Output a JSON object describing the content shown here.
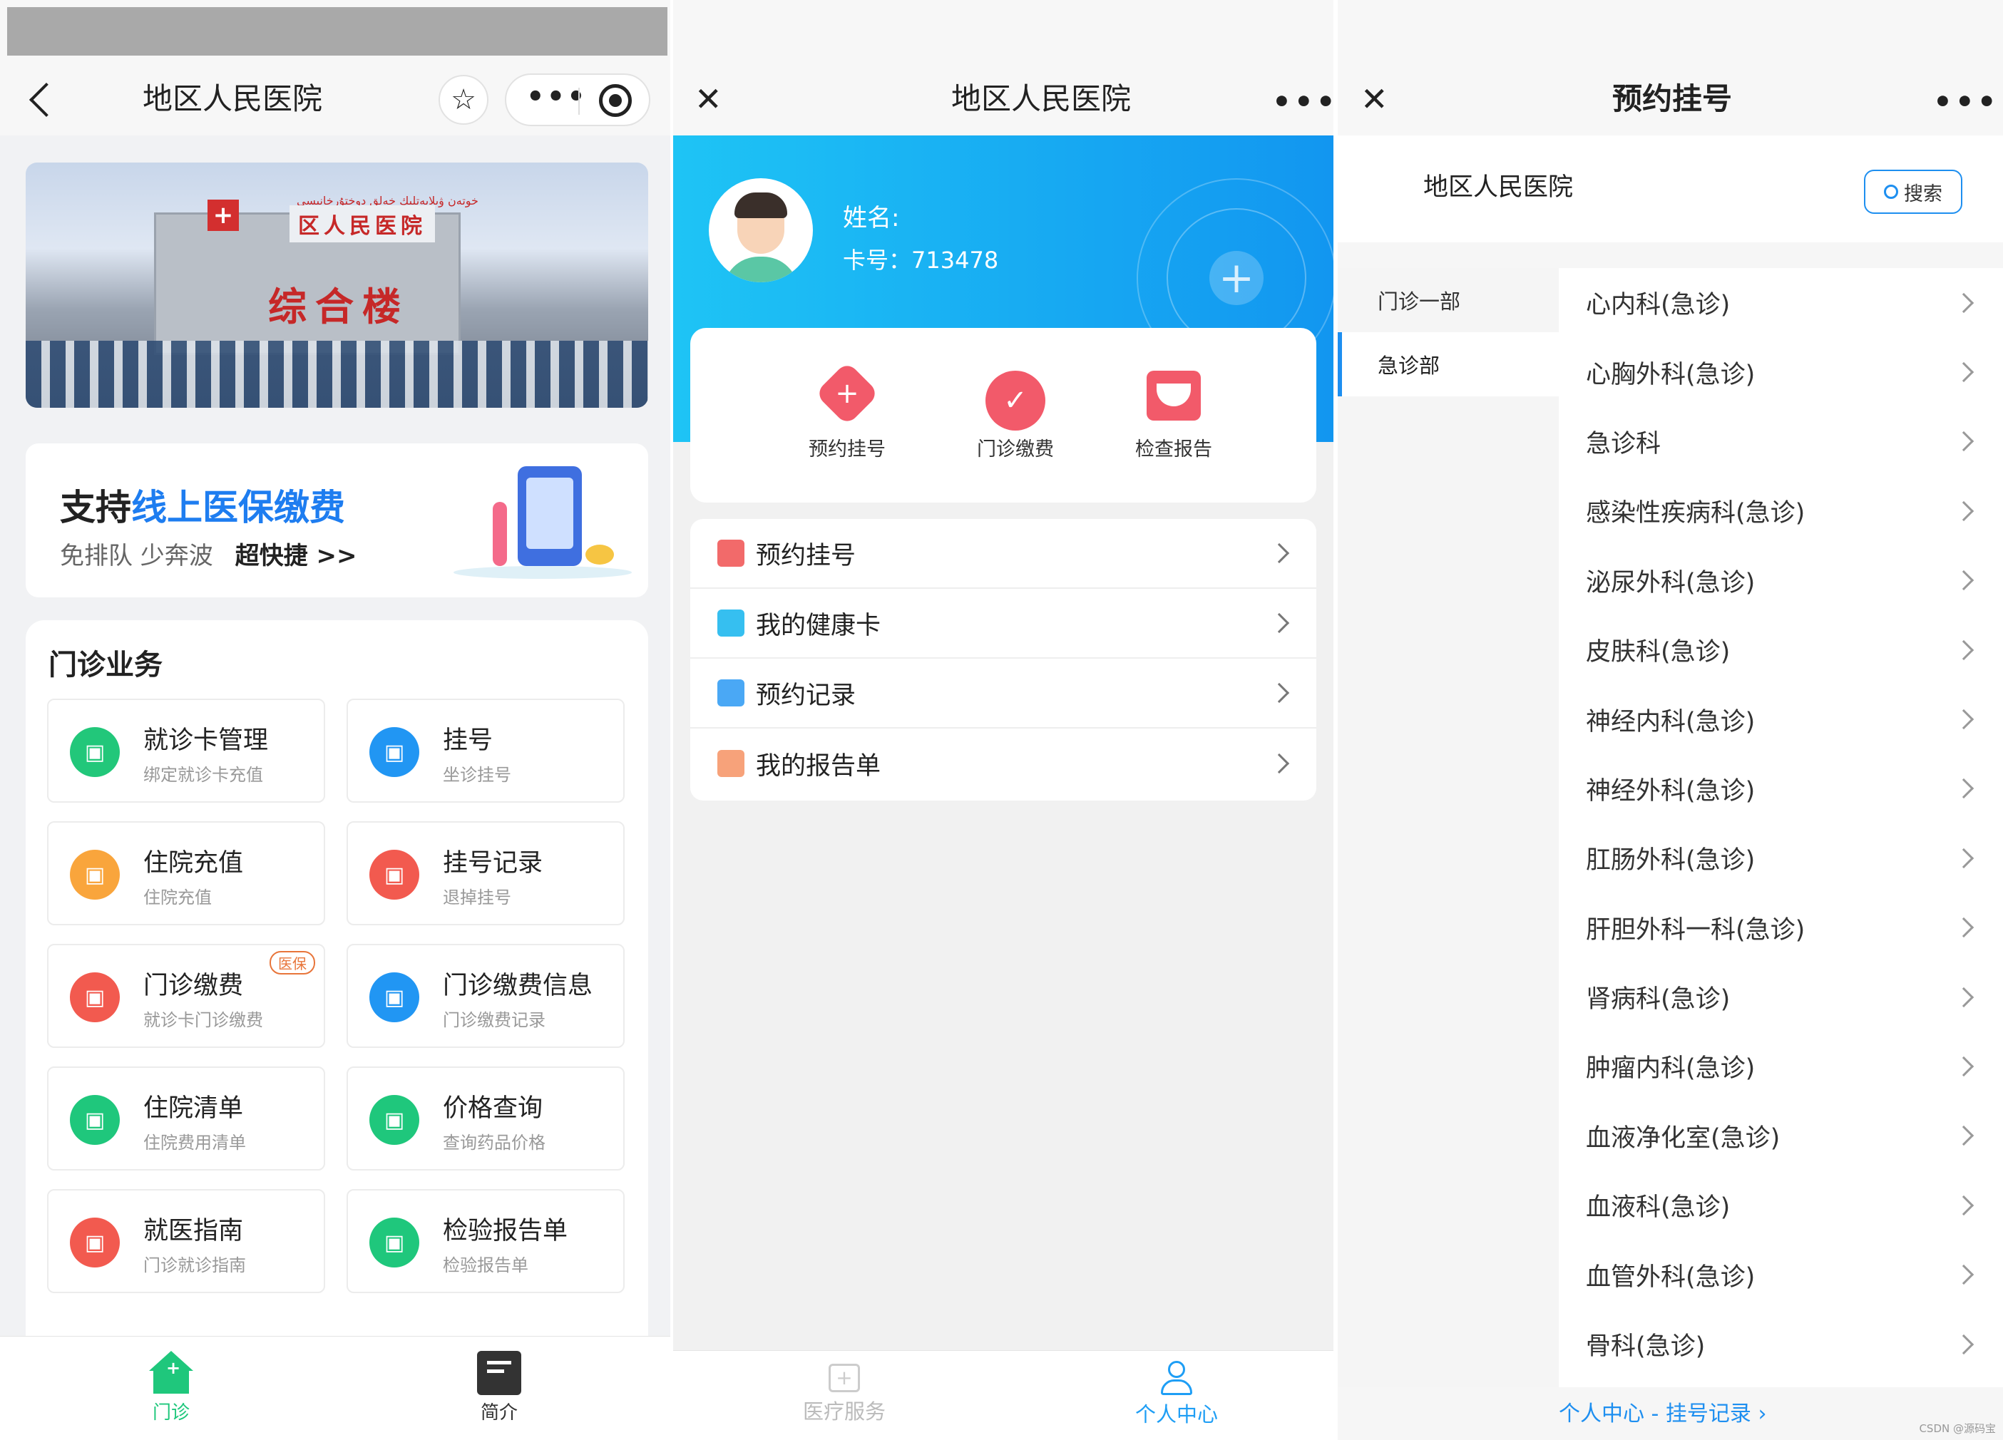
{
  "panel1": {
    "title": "地区人民医院",
    "banner": {
      "sign_top": "خوتەن ۋىلايەتلىك خەلق دوختۇرخانىسى",
      "sign": "区人民医院",
      "building": "综合楼"
    },
    "promo": {
      "line1_a": "支持",
      "line1_b": "线上医保缴费",
      "line2_a": "免排队 少奔波",
      "line2_b": "超快捷 >>"
    },
    "section_title": "门诊业务",
    "tiles": [
      {
        "title": "就诊卡管理",
        "sub": "绑定就诊卡充值",
        "color": "#22c77a",
        "icon": "card-icon"
      },
      {
        "title": "挂号",
        "sub": "坐诊挂号",
        "color": "#2196f3",
        "icon": "clock-icon"
      },
      {
        "title": "住院充值",
        "sub": "住院充值",
        "color": "#f9a53c",
        "icon": "recharge-icon"
      },
      {
        "title": "挂号记录",
        "sub": "退掉挂号",
        "color": "#f25a4f",
        "icon": "refund-icon"
      },
      {
        "title": "门诊缴费",
        "sub": "就诊卡门诊缴费",
        "color": "#f25a4f",
        "icon": "payment-icon",
        "badge": "医保"
      },
      {
        "title": "门诊缴费信息",
        "sub": "门诊缴费记录",
        "color": "#2196f3",
        "icon": "list-icon"
      },
      {
        "title": "住院清单",
        "sub": "住院费用清单",
        "color": "#1fc77c",
        "icon": "bill-icon"
      },
      {
        "title": "价格查询",
        "sub": "查询药品价格",
        "color": "#1fc77c",
        "icon": "price-icon"
      },
      {
        "title": "就医指南",
        "sub": "门诊就诊指南",
        "color": "#f25a4f",
        "icon": "guide-icon"
      },
      {
        "title": "检验报告单",
        "sub": "检验报告单",
        "color": "#1fc77c",
        "icon": "report-icon"
      }
    ],
    "tabs": [
      {
        "label": "门诊",
        "color": "#1fc77c"
      },
      {
        "label": "简介",
        "color": "#333333"
      }
    ]
  },
  "panel2": {
    "title": "地区人民医院",
    "name_label": "姓名:",
    "card_label": "卡号：",
    "card_no": "713478",
    "features": [
      {
        "label": "预约挂号",
        "color": "#f25a6a"
      },
      {
        "label": "门诊缴费",
        "color": "#f25a6a"
      },
      {
        "label": "检查报告",
        "color": "#f25a6a"
      }
    ],
    "menu": [
      {
        "label": "预约挂号",
        "color": "#f26a6a"
      },
      {
        "label": "我的健康卡",
        "color": "#36bff0"
      },
      {
        "label": "预约记录",
        "color": "#4aa8f5"
      },
      {
        "label": "我的报告单",
        "color": "#f7a27a"
      }
    ],
    "tabs": [
      {
        "label": "医疗服务",
        "color": "#bbbbbb"
      },
      {
        "label": "个人中心",
        "color": "#1e9ef5"
      }
    ]
  },
  "panel3": {
    "title": "预约挂号",
    "hospital": "地区人民医院",
    "search": "搜索",
    "sidebar": [
      {
        "label": "门诊一部"
      },
      {
        "label": "急诊部"
      }
    ],
    "departments": [
      "心内科(急诊)",
      "心胸外科(急诊)",
      "急诊科",
      "感染性疾病科(急诊)",
      "泌尿外科(急诊)",
      "皮肤科(急诊)",
      "神经内科(急诊)",
      "神经外科(急诊)",
      "肛肠外科(急诊)",
      "肝胆外科一科(急诊)",
      "肾病科(急诊)",
      "肿瘤内科(急诊)",
      "血液净化室(急诊)",
      "血液科(急诊)",
      "血管外科(急诊)",
      "骨科(急诊)"
    ],
    "footer_link": "个人中心 - 挂号记录",
    "watermark": "CSDN @源码宝",
    "accent": "#1e8ff0"
  }
}
